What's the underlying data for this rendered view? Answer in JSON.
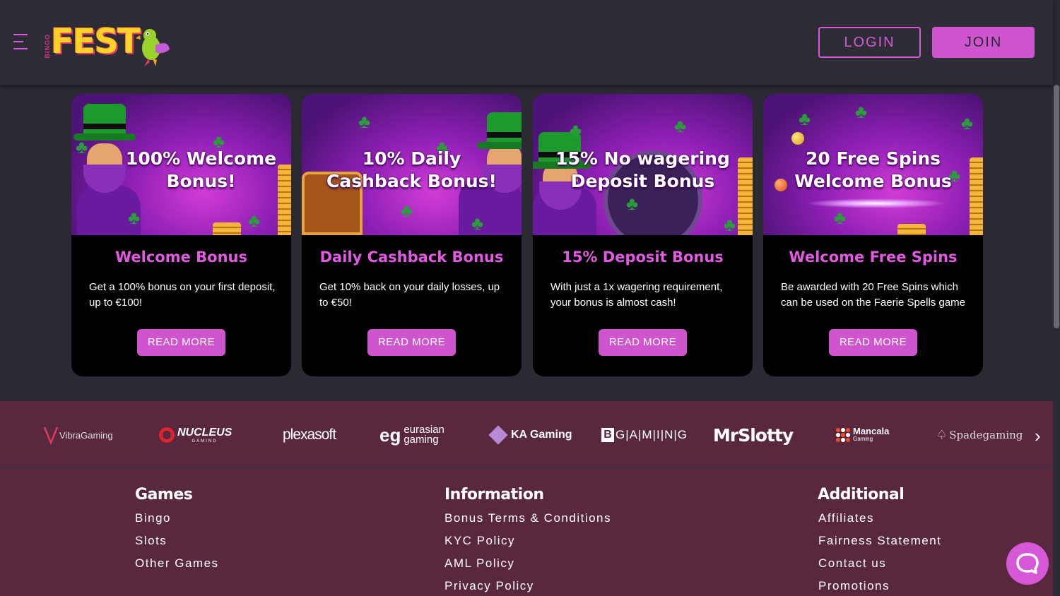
{
  "header": {
    "logo_small": "BINGO",
    "logo_main": "FEST",
    "login_label": "LOGIN",
    "join_label": "JOIN"
  },
  "colors": {
    "accent": "#cf55cf",
    "background": "#2b2a33",
    "footer": "#59283f"
  },
  "cards": [
    {
      "image_text_line1": "100% Welcome",
      "image_text_line2": "Bonus!",
      "title": "Welcome Bonus",
      "description": "Get a 100% bonus on your first deposit, up to €100!",
      "button": "READ MORE"
    },
    {
      "image_text_line1": "10% Daily",
      "image_text_line2": "Cashback Bonus!",
      "title": "Daily Cashback Bonus",
      "description": "Get 10% back on your daily losses, up to €50!",
      "button": "READ MORE"
    },
    {
      "image_text_line1": "15% No wagering",
      "image_text_line2": "Deposit Bonus",
      "title": "15% Deposit Bonus",
      "description": "With just a 1x wagering requirement, your bonus is almost cash!",
      "button": "READ MORE"
    },
    {
      "image_text_line1": "20 Free Spins",
      "image_text_line2": "Welcome Bonus",
      "title": "Welcome Free Spins",
      "description": "Be awarded with 20 Free Spins which can be used on the Faerie Spells game",
      "button": "READ MORE"
    }
  ],
  "providers": {
    "vibra": "VibraGaming",
    "nucleus": "NUCLEUS",
    "nucleus_sub": "GAMING",
    "plexasoft": "plexasoft",
    "eurasian_1": "eurasian",
    "eurasian_2": "gaming",
    "ka": "KA Gaming",
    "bgaming": "G|A|M|I|N|G",
    "bgaming_b": "B",
    "mrslotty": "MrSlotty",
    "mancala": "Mancala",
    "mancala_sub": "Gaming",
    "spadegaming": "Spadegaming"
  },
  "footer": {
    "games": {
      "title": "Games",
      "links": [
        "Bingo",
        "Slots",
        "Other Games"
      ]
    },
    "information": {
      "title": "Information",
      "links": [
        "Bonus Terms & Conditions",
        "KYC Policy",
        "AML Policy",
        "Privacy Policy"
      ]
    },
    "additional": {
      "title": "Additional",
      "links": [
        "Affiliates",
        "Fairness Statement",
        "Contact us",
        "Promotions"
      ]
    }
  }
}
